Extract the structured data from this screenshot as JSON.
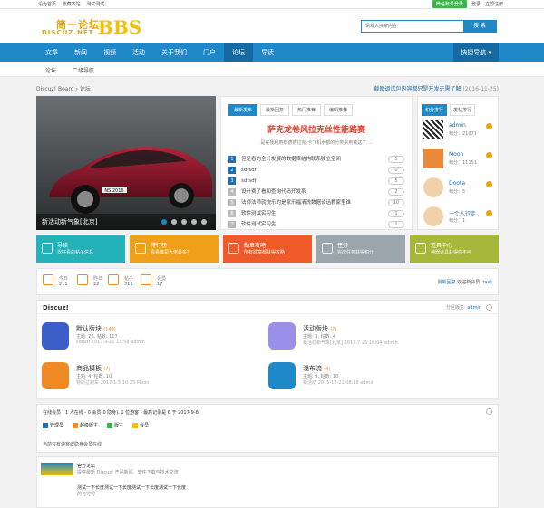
{
  "topbar": {
    "links": [
      "设为首页",
      "收藏本站",
      "测试测试"
    ],
    "wechat": "微信账号登录",
    "login": "登录",
    "register": "立即注册"
  },
  "logo": {
    "cn": "简一论坛",
    "en": "DISCUZ.NET",
    "bbs": "BBS"
  },
  "search": {
    "placeholder": "请输入搜索内容",
    "button": "搜 索"
  },
  "nav": {
    "items": [
      "文章",
      "新闻",
      "视频",
      "活动",
      "关于我们",
      "门户",
      "论坛",
      "导读"
    ],
    "active": "论坛",
    "quick": "快捷导航"
  },
  "subnav": {
    "items": [
      "论坛",
      "二级导航"
    ]
  },
  "crumb": "Discuz! Board › 论坛",
  "notice": {
    "text": "截图调试包内容都只是开发无需了解",
    "date": "(2016-11-25)"
  },
  "slider": {
    "caption": "新活动新气象[北京]",
    "plate": "NS 2016"
  },
  "center": {
    "tabs": [
      "最新发布",
      "最新回复",
      "热门推荐",
      "编辑推荐"
    ],
    "headline": "萨克龙卷风拉克丝性能路赛",
    "summary": "是在我利用斯德德拉克-卡飞机水都的分类来用钱这了 ...",
    "threads": [
      {
        "n": "1",
        "title": "但是看的全计发展的数据库结构联系独立空间",
        "count": "5"
      },
      {
        "n": "2",
        "title": "sdfsdf",
        "count": "0"
      },
      {
        "n": "3",
        "title": "sdfsdf",
        "count": "5"
      },
      {
        "n": "4",
        "title": "设计费了看和查询代码开发系",
        "count": "2"
      },
      {
        "n": "5",
        "title": "法师法师就快乐的是家乐福清洗数据谈话教家里谁",
        "count": "10"
      },
      {
        "n": "6",
        "title": "软件测试实习生",
        "count": "1"
      },
      {
        "n": "7",
        "title": "软件测试实习生",
        "count": "1"
      }
    ]
  },
  "rank": {
    "tabs": [
      "积分排行",
      "发帖排行"
    ],
    "users": [
      {
        "name": "admin",
        "score": "积分：21971"
      },
      {
        "name": "Moon",
        "score": "积分：11151"
      },
      {
        "name": "Doota",
        "score": "积分：5"
      },
      {
        "name": "一个人行走",
        "score": "积分：1"
      }
    ]
  },
  "tiles": [
    {
      "title": "导读",
      "desc": "找好看的帖子信息",
      "color": "#25b1b8"
    },
    {
      "title": "排行榜",
      "desc": "看看谁是大佬最多？",
      "color": "#f0a018"
    },
    {
      "title": "勋章攻略",
      "desc": "所有勋章都获得攻略",
      "color": "#ee5a2a"
    },
    {
      "title": "任务",
      "desc": "完成任务获得积分",
      "color": "#9aa6ab"
    },
    {
      "title": "道具中心",
      "desc": "神器道具获得你不可",
      "color": "#a6b83a"
    }
  ],
  "stats": [
    {
      "label": "今日",
      "value": "211"
    },
    {
      "label": "昨日",
      "value": "22"
    },
    {
      "label": "帖子",
      "value": "315"
    },
    {
      "label": "会员",
      "value": "17"
    }
  ],
  "newest": {
    "label": "最新回复",
    "welcome": "欢迎新会员:",
    "user": "task"
  },
  "forum": {
    "title": "Discuz!",
    "moderator_label": "分区版主:",
    "moderator": "admin",
    "boards": [
      {
        "name": "默认版块",
        "count": "(149)",
        "stats": "主题: 26, 帖数: 117",
        "last": "sdfsdf 2017-9-11 15:58 admin",
        "color": "#3b5ec9"
      },
      {
        "name": "活动版块",
        "count": "(7)",
        "stats": "主题: 3, 帖数: 4",
        "last": "新活动新气象[北京] 2017-7-25 16:04 admin",
        "color": "#9b8fe8"
      },
      {
        "name": "商品模板",
        "count": "(7)",
        "stats": "主题: 4, 帖数: 10",
        "last": "特斯拉跑车 2017-1-5 10:25 Moon",
        "color": "#f08a24"
      },
      {
        "name": "瀑布流",
        "count": "(4)",
        "stats": "主题: 9, 帖数: 10",
        "last": "新活动 2015-12-21 08:18 admin",
        "color": "#1e88c8"
      }
    ]
  },
  "online": {
    "header": "在线会员 - 1 人在线 - 0 会员(0 隐身), 1 位游客 - 最高记录是 6 于 2017-9-8.",
    "legend": [
      {
        "label": "管理员",
        "color": "#1e6fb3"
      },
      {
        "label": "超级版主",
        "color": "#f08a24"
      },
      {
        "label": "版主",
        "color": "#3bb54a"
      },
      {
        "label": "会员",
        "color": "#f4c000"
      }
    ],
    "none": "当前只有游客或隐身会员在线"
  },
  "links": {
    "name1": "官方论坛",
    "desc1": "提供最新 Discuz! 产品新闻、软件下载与技术交流",
    "name2": "测试一下长度测试一下长度测试一下长度测试一下长度",
    "desc2": "的与得得"
  }
}
